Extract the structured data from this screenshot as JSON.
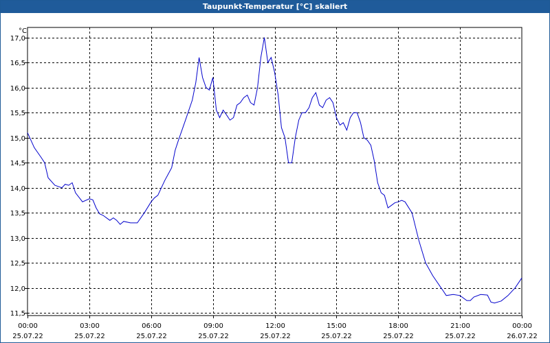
{
  "window": {
    "title": "Taupunkt-Temperatur [°C] skaliert"
  },
  "colors": {
    "titlebar": "#1f5b9a",
    "line": "#0000cc",
    "grid": "#000000"
  },
  "chart_data": {
    "type": "line",
    "title": "Taupunkt-Temperatur [°C] skaliert",
    "ylabel": "°C",
    "xlabel": "",
    "ylim": [
      11.45,
      17.2
    ],
    "xlim_hours": [
      0,
      24
    ],
    "grid": true,
    "y_ticks": [
      "17,0",
      "16,5",
      "16,0",
      "15,5",
      "15,0",
      "14,5",
      "14,0",
      "13,5",
      "13,0",
      "12,5",
      "12,0",
      "11,5"
    ],
    "y_tick_values": [
      17.0,
      16.5,
      16.0,
      15.5,
      15.0,
      14.5,
      14.0,
      13.5,
      13.0,
      12.5,
      12.0,
      11.5
    ],
    "x_ticks": [
      {
        "time": "00:00",
        "date": "25.07.22"
      },
      {
        "time": "03:00",
        "date": "25.07.22"
      },
      {
        "time": "06:00",
        "date": "25.07.22"
      },
      {
        "time": "09:00",
        "date": "25.07.22"
      },
      {
        "time": "12:00",
        "date": "25.07.22"
      },
      {
        "time": "15:00",
        "date": "25.07.22"
      },
      {
        "time": "18:00",
        "date": "25.07.22"
      },
      {
        "time": "21:00",
        "date": "25.07.22"
      },
      {
        "time": "00:00",
        "date": "26.07.22"
      }
    ],
    "series": [
      {
        "x_hours": [
          0.0,
          0.33,
          0.67,
          0.83,
          1.0,
          1.33,
          1.67,
          1.83,
          2.0,
          2.17,
          2.33,
          2.67,
          3.0,
          3.17,
          3.33,
          3.5,
          3.67,
          4.0,
          4.17,
          4.33,
          4.5,
          4.67,
          5.0,
          5.17,
          5.33,
          5.67,
          6.0,
          6.17,
          6.33,
          6.67,
          7.0,
          7.17,
          7.33,
          7.67,
          8.0,
          8.17,
          8.33,
          8.5,
          8.67,
          8.83,
          9.0,
          9.17,
          9.33,
          9.5,
          9.67,
          9.83,
          10.0,
          10.17,
          10.33,
          10.5,
          10.67,
          10.83,
          11.0,
          11.17,
          11.33,
          11.5,
          11.67,
          11.83,
          12.0,
          12.17,
          12.33,
          12.5,
          12.67,
          12.83,
          13.0,
          13.17,
          13.33,
          13.5,
          13.67,
          13.83,
          14.0,
          14.17,
          14.33,
          14.5,
          14.67,
          14.83,
          15.0,
          15.17,
          15.33,
          15.5,
          15.67,
          15.83,
          16.0,
          16.17,
          16.33,
          16.5,
          16.67,
          16.83,
          17.0,
          17.17,
          17.33,
          17.5,
          17.67,
          17.83,
          18.0,
          18.17,
          18.33,
          18.67,
          19.0,
          19.33,
          19.67,
          20.0,
          20.17,
          20.33,
          20.67,
          21.0,
          21.33,
          21.5,
          21.67,
          22.0,
          22.33,
          22.5,
          22.67,
          23.0,
          23.33,
          23.67,
          24.0
        ],
        "values": [
          15.1,
          14.8,
          14.6,
          14.5,
          14.2,
          14.05,
          14.0,
          14.07,
          14.05,
          14.1,
          13.9,
          13.72,
          13.78,
          13.76,
          13.6,
          13.48,
          13.45,
          13.35,
          13.4,
          13.35,
          13.27,
          13.33,
          13.3,
          13.3,
          13.3,
          13.5,
          13.72,
          13.8,
          13.85,
          14.15,
          14.4,
          14.75,
          14.95,
          15.35,
          15.75,
          16.1,
          16.6,
          16.2,
          16.0,
          15.95,
          16.2,
          15.55,
          15.4,
          15.55,
          15.45,
          15.35,
          15.4,
          15.65,
          15.7,
          15.8,
          15.85,
          15.7,
          15.65,
          16.0,
          16.6,
          17.0,
          16.5,
          16.6,
          16.3,
          15.85,
          15.2,
          15.0,
          14.5,
          14.5,
          15.0,
          15.35,
          15.5,
          15.5,
          15.6,
          15.8,
          15.9,
          15.65,
          15.6,
          15.75,
          15.8,
          15.7,
          15.4,
          15.25,
          15.3,
          15.15,
          15.4,
          15.5,
          15.5,
          15.3,
          15.0,
          14.95,
          14.85,
          14.55,
          14.1,
          13.9,
          13.85,
          13.6,
          13.65,
          13.7,
          13.72,
          13.75,
          13.72,
          13.5,
          12.95,
          12.5,
          12.25,
          12.05,
          11.95,
          11.85,
          11.87,
          11.85,
          11.75,
          11.75,
          11.82,
          11.87,
          11.86,
          11.72,
          11.7,
          11.74,
          11.85,
          12.0,
          12.2
        ]
      }
    ]
  }
}
